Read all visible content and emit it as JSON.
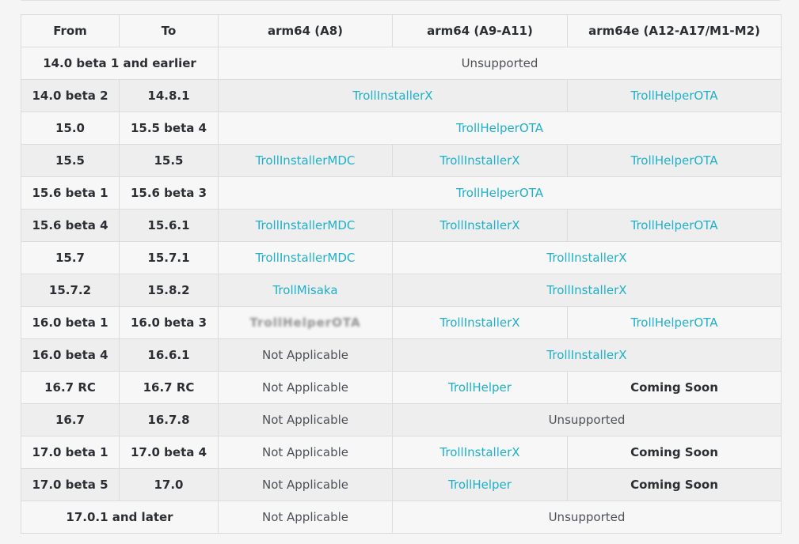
{
  "headers": {
    "from": "From",
    "to": "To",
    "a8": "arm64 (A8)",
    "a9": "arm64 (A9-A11)",
    "a12": "arm64e (A12-A17/M1-M2)"
  },
  "rows": [
    {
      "range": "14.0 beta 1 and earlier",
      "all": "Unsupported"
    },
    {
      "from": "14.0 beta 2",
      "to": "14.8.1",
      "a8a9": "TrollInstallerX",
      "a12": "TrollHelperOTA"
    },
    {
      "from": "15.0",
      "to": "15.5 beta 4",
      "all": "TrollHelperOTA"
    },
    {
      "from": "15.5",
      "to": "15.5",
      "a8": "TrollInstallerMDC",
      "a9": "TrollInstallerX",
      "a12": "TrollHelperOTA"
    },
    {
      "from": "15.6 beta 1",
      "to": "15.6 beta 3",
      "all": "TrollHelperOTA"
    },
    {
      "from": "15.6 beta 4",
      "to": "15.6.1",
      "a8": "TrollInstallerMDC",
      "a9": "TrollInstallerX",
      "a12": "TrollHelperOTA"
    },
    {
      "from": "15.7",
      "to": "15.7.1",
      "a8": "TrollInstallerMDC",
      "a9a12": "TrollInstallerX"
    },
    {
      "from": "15.7.2",
      "to": "15.8.2",
      "a8": "TrollMisaka",
      "a9a12": "TrollInstallerX"
    },
    {
      "from": "16.0 beta 1",
      "to": "16.0 beta 3",
      "a8": "TrollHelperOTA",
      "a9": "TrollInstallerX",
      "a12": "TrollHelperOTA"
    },
    {
      "from": "16.0 beta 4",
      "to": "16.6.1",
      "a8": "Not Applicable",
      "a9a12": "TrollInstallerX"
    },
    {
      "from": "16.7 RC",
      "to": "16.7 RC",
      "a8": "Not Applicable",
      "a9": "TrollHelper",
      "a12": "Coming Soon"
    },
    {
      "from": "16.7",
      "to": "16.7.8",
      "a8": "Not Applicable",
      "a9a12": "Unsupported"
    },
    {
      "from": "17.0 beta 1",
      "to": "17.0 beta 4",
      "a8": "Not Applicable",
      "a9": "TrollInstallerX",
      "a12": "Coming Soon"
    },
    {
      "from": "17.0 beta 5",
      "to": "17.0",
      "a8": "Not Applicable",
      "a9": "TrollHelper",
      "a12": "Coming Soon"
    },
    {
      "range": "17.0.1 and later",
      "a8": "Not Applicable",
      "a9a12": "Unsupported"
    }
  ]
}
